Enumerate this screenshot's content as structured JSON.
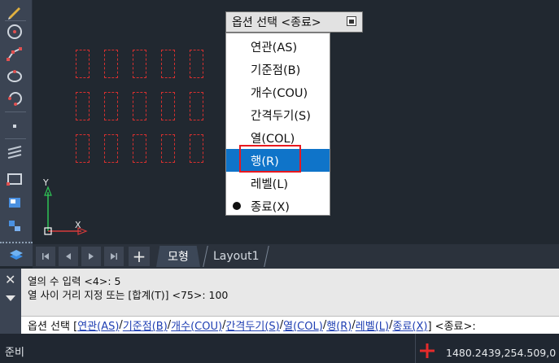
{
  "popup": {
    "title": "옵션 선택 <종료>",
    "items": [
      {
        "label": "연관(AS)"
      },
      {
        "label": "기준점(B)"
      },
      {
        "label": "개수(COU)"
      },
      {
        "label": "간격두기(S)"
      },
      {
        "label": "열(COL)"
      },
      {
        "label": "행(R)"
      },
      {
        "label": "레벨(L)"
      },
      {
        "label": "종료(X)"
      }
    ],
    "selected_index": 5
  },
  "canvas": {
    "ucs_y_label": "Y",
    "ucs_x_label": "X"
  },
  "tabs": {
    "model": "모형",
    "layout1": "Layout1"
  },
  "command": {
    "history": [
      "열의 수 입력 <4>: 5",
      "열 사이 거리 지정 또는 [합계(T)] <75>: 100"
    ],
    "prompt_prefix": "옵션 선택 [",
    "options": [
      {
        "name": "연관",
        "key": "AS"
      },
      {
        "name": "기준점",
        "key": "B"
      },
      {
        "name": "개수",
        "key": "COU"
      },
      {
        "name": "간격두기",
        "key": "S"
      },
      {
        "name": "열",
        "key": "COL"
      },
      {
        "name": "행",
        "key": "R"
      },
      {
        "name": "레벨",
        "key": "L"
      },
      {
        "name": "종료",
        "key": "X"
      }
    ],
    "prompt_suffix": "] <종료>:"
  },
  "status": {
    "ready": "준비",
    "coords": "1480.2439,254.509,0"
  },
  "colors": {
    "canvas_bg": "#212830",
    "selection_blue": "#0f74c9",
    "highlight_red": "#e8181f",
    "dashed_red": "#d8302f"
  }
}
